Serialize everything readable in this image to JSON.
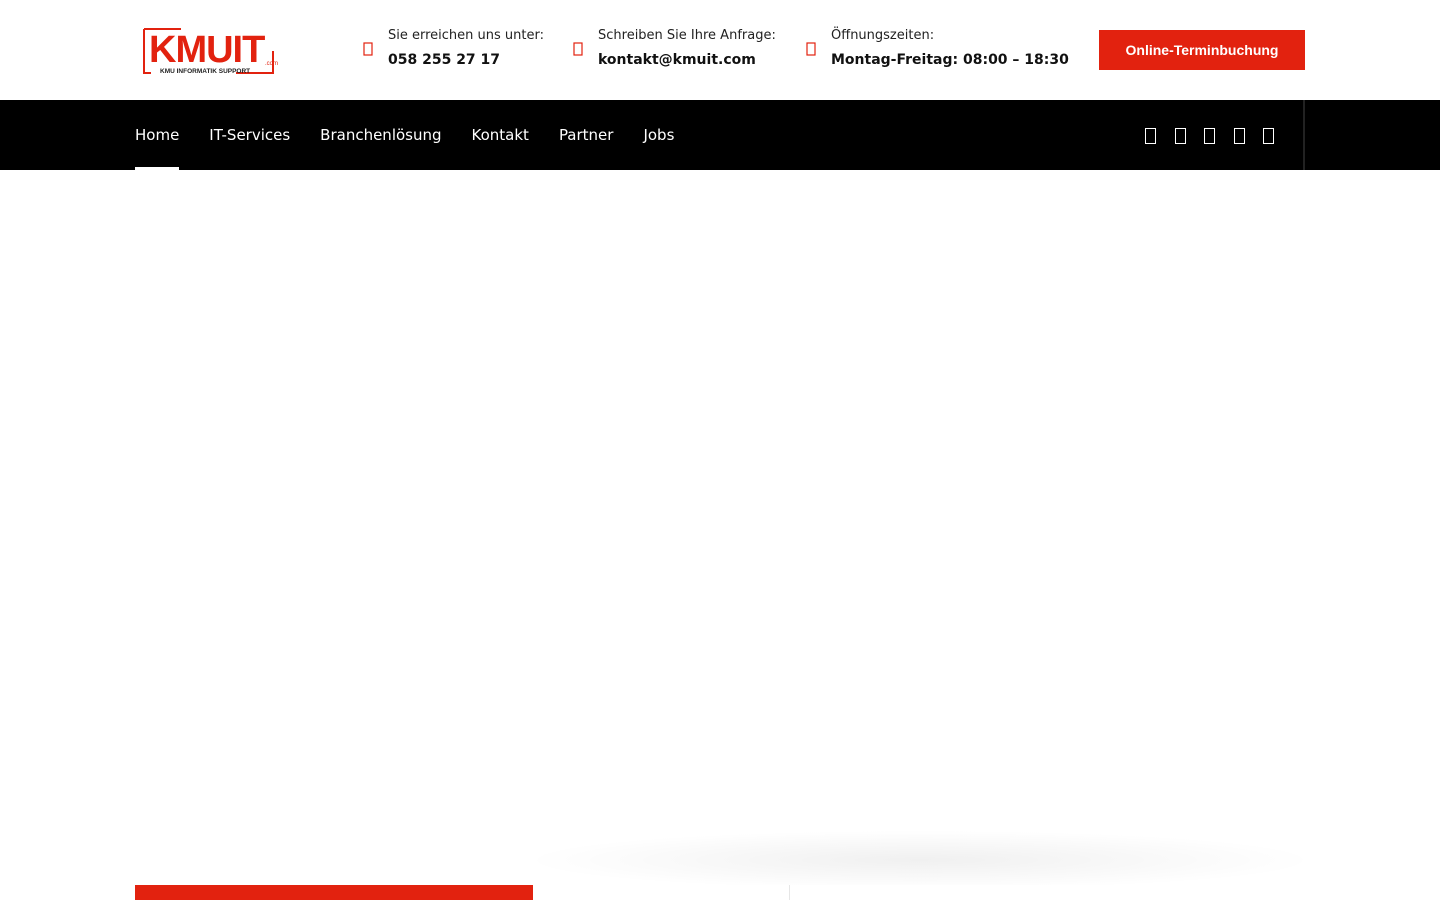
{
  "brand": {
    "name": "KMUIT",
    "suffix": ".com",
    "tagline": "KMU INFORMATIK SUPPORT",
    "accent": "#e2220f"
  },
  "header": {
    "phone": {
      "label": "Sie erreichen uns unter:",
      "value": "058 255 27 17",
      "icon": "phone-icon"
    },
    "email": {
      "label": "Schreiben Sie Ihre Anfrage:",
      "value": "kontakt@kmuit.com",
      "icon": "envelope-icon"
    },
    "hours": {
      "label": "Öffnungszeiten:",
      "value": "Montag-Freitag: 08:00 – 18:30",
      "icon": "clock-icon"
    },
    "cta_label": "Online-Terminbuchung"
  },
  "nav": {
    "items": [
      {
        "label": "Home",
        "active": true
      },
      {
        "label": "IT-Services"
      },
      {
        "label": "Branchenlösung"
      },
      {
        "label": "Kontakt"
      },
      {
        "label": "Partner"
      },
      {
        "label": "Jobs"
      }
    ],
    "social": [
      "facebook-icon",
      "twitter-icon",
      "linkedin-icon",
      "instagram-icon",
      "youtube-icon"
    ]
  }
}
